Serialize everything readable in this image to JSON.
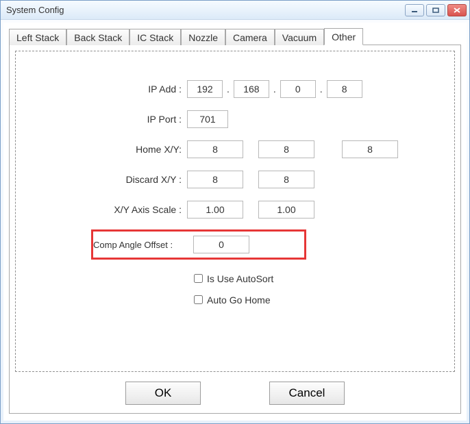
{
  "window": {
    "title": "System Config"
  },
  "tabs": [
    {
      "label": "Left Stack"
    },
    {
      "label": "Back Stack"
    },
    {
      "label": "IC Stack"
    },
    {
      "label": "Nozzle"
    },
    {
      "label": "Camera"
    },
    {
      "label": "Vacuum"
    },
    {
      "label": "Other"
    }
  ],
  "active_tab_index": 6,
  "form": {
    "ip_add": {
      "label": "IP Add :",
      "a": "192",
      "b": "168",
      "c": "0",
      "d": "8"
    },
    "ip_port": {
      "label": "IP Port :",
      "value": "701"
    },
    "home_xy": {
      "label": "Home X/Y:",
      "x": "8",
      "y": "8",
      "z": "8"
    },
    "discard_xy": {
      "label": "Discard X/Y :",
      "x": "8",
      "y": "8"
    },
    "axis_scale": {
      "label": "X/Y Axis Scale :",
      "x": "1.00",
      "y": "1.00"
    },
    "comp_angle": {
      "label": "Comp Angle Offset :",
      "value": "0"
    },
    "autosort": {
      "label": "Is Use AutoSort",
      "checked": false
    },
    "autohome": {
      "label": "Auto Go Home",
      "checked": false
    }
  },
  "buttons": {
    "ok": "OK",
    "cancel": "Cancel"
  },
  "dot": "."
}
